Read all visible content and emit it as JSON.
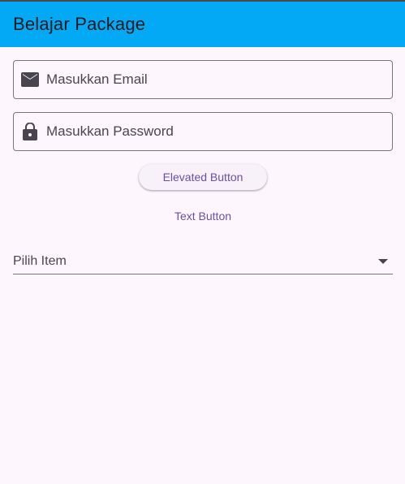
{
  "appbar": {
    "title": "Belajar Package",
    "color": "#03a9f4"
  },
  "email_field": {
    "placeholder": "Masukkan Email",
    "value": "",
    "icon": "mail-icon"
  },
  "password_field": {
    "placeholder": "Masukkan Password",
    "value": "",
    "icon": "lock-icon"
  },
  "elevated_button": {
    "label": "Elevated Button"
  },
  "text_button": {
    "label": "Text Button"
  },
  "dropdown": {
    "hint": "Pilih Item",
    "icon": "arrow-drop-down-icon"
  },
  "colors": {
    "accent": "#6750a4",
    "background": "#fdf7fd",
    "outline": "#79747e"
  }
}
